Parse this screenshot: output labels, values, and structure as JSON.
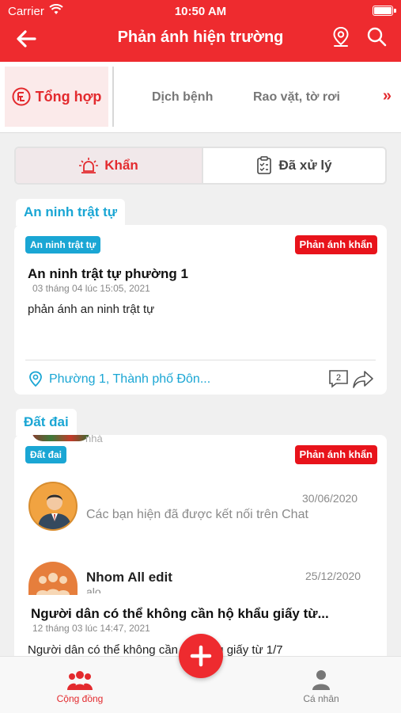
{
  "status_bar": {
    "carrier": "Carrier",
    "time": "10:50 AM"
  },
  "header": {
    "title": "Phản ánh hiện trường"
  },
  "categories": {
    "active": "Tổng hợp",
    "items": [
      "Dịch bệnh",
      "Rao vặt, tờ rơi"
    ],
    "more": "»"
  },
  "segment": {
    "urgent": "Khẩn",
    "processed": "Đã xử lý"
  },
  "sections": [
    {
      "title": "An ninh trật tự",
      "tag": "An ninh trật tự",
      "badge": "Phản ánh khẩn",
      "post_title": "An ninh trật tự phường 1",
      "date": "03 tháng 04 lúc 15:05, 2021",
      "body": "phản ánh an ninh trật tự",
      "location": "Phường 1, Thành phố Đôn...",
      "comments": "2"
    },
    {
      "title": "Đất đai",
      "tag": "Đất đai",
      "badge": "Phản ánh khẩn",
      "post_title": "Người dân có thể không cần hộ khẩu giấy từ...",
      "date": "12 tháng 03 lúc 14:47, 2021",
      "body": "Người dân có thể không cần hộ khẩu giấy từ 1/7"
    }
  ],
  "chat_overlay": [
    {
      "name": "",
      "message": "Các bạn hiện đã được kết nối trên Chat",
      "date": "30/06/2020",
      "partial_top": "nhà"
    },
    {
      "name": "Nhom All edit",
      "message": "alo",
      "date": "25/12/2020"
    }
  ],
  "tabbar": {
    "community": "Cộng đồng",
    "personal": "Cá nhân"
  },
  "colors": {
    "brand": "#ee2b2f",
    "accent_blue": "#1aa6d4",
    "urgent_red": "#e8131b"
  }
}
